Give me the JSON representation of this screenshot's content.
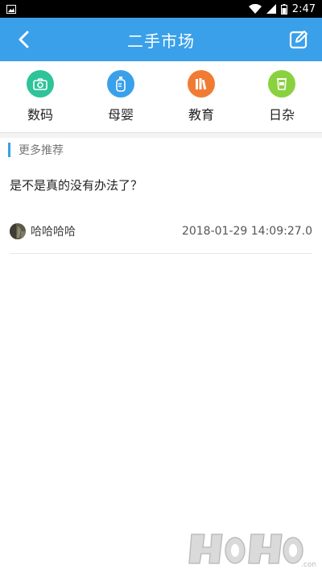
{
  "status_bar": {
    "time": "2:47"
  },
  "header": {
    "title": "二手市场"
  },
  "categories": [
    {
      "label": "数码",
      "color": "#2fc39a",
      "icon": "camera-icon"
    },
    {
      "label": "母婴",
      "color": "#3aa0ea",
      "icon": "baby-bottle-icon"
    },
    {
      "label": "教育",
      "color": "#f07c33",
      "icon": "books-icon"
    },
    {
      "label": "日杂",
      "color": "#8ad13f",
      "icon": "cup-icon"
    }
  ],
  "section": {
    "title": "更多推荐"
  },
  "post": {
    "title": "是不是真的没有办法了？",
    "author": "哈哈哈哈",
    "time": "2018-01-29 14:09:27.0"
  },
  "colors": {
    "app_bar": "#3aa0ea",
    "accent": "#3aa0ea"
  }
}
